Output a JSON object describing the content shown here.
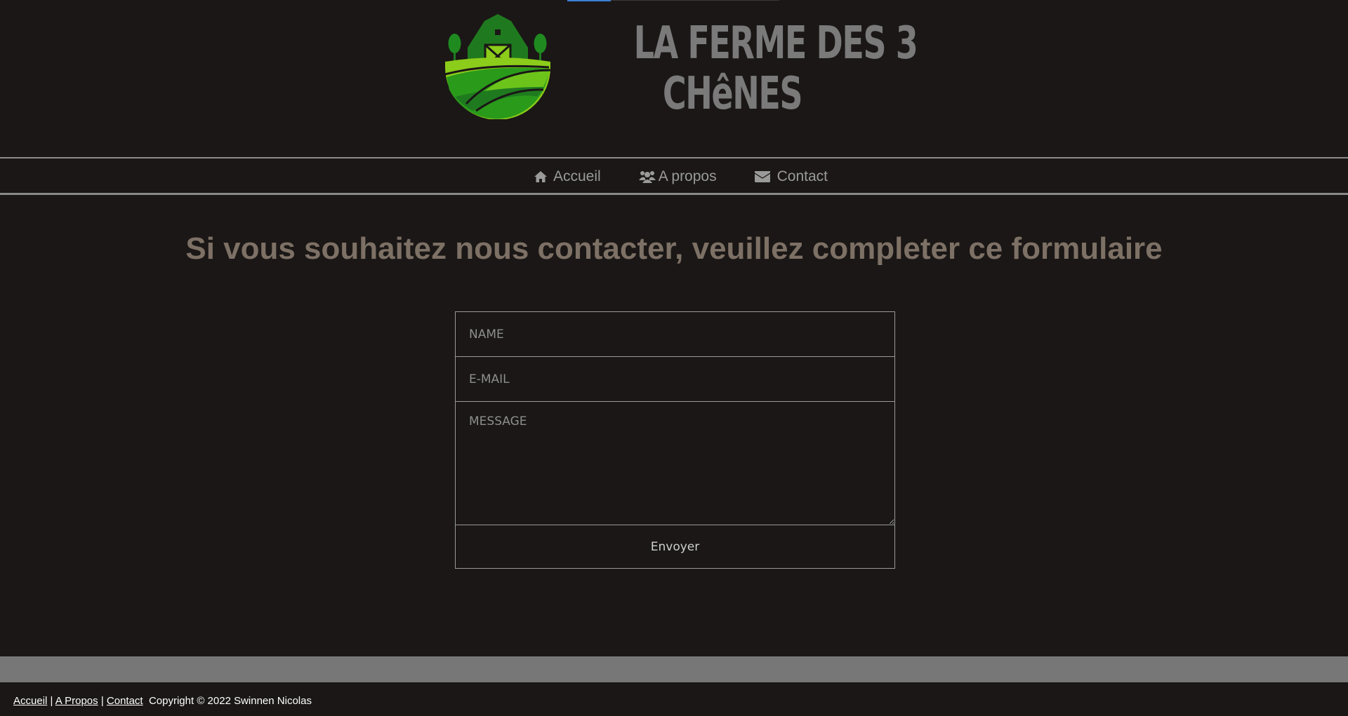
{
  "header": {
    "brand_line1": "LA FERME DES 3",
    "brand_line2": "CHêNES",
    "logo_icon": "farm-barn-logo"
  },
  "nav": {
    "items": [
      {
        "label": "Accueil",
        "icon": "home-icon"
      },
      {
        "label": "A propos",
        "icon": "users-icon"
      },
      {
        "label": "Contact",
        "icon": "envelope-icon"
      }
    ]
  },
  "main": {
    "headline": "Si vous souhaitez nous contacter, veuillez completer ce formulaire"
  },
  "form": {
    "name_placeholder": "NAME",
    "email_placeholder": "E-MAIL",
    "message_placeholder": "MESSAGE",
    "submit_label": "Envoyer"
  },
  "footer": {
    "links": [
      "Accueil",
      "A Propos",
      "Contact"
    ],
    "separator": "|",
    "copyright": "Copyright © 2022 Swinnen Nicolas"
  },
  "colors": {
    "background": "#1a1716",
    "headline": "#7d7065",
    "nav_text": "#9a9a9a",
    "brand_text": "#7a7a7a",
    "band": "#777777",
    "logo_green_dark": "#1f7a1f",
    "logo_green_light": "#8ccc1a"
  }
}
